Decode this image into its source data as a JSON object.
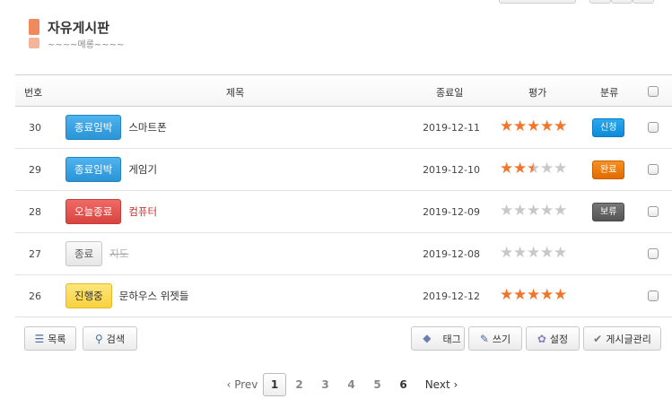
{
  "board": {
    "title": "자유게시판",
    "subtitle": "~~~~메롱~~~~"
  },
  "table": {
    "headers": {
      "no": "번호",
      "title": "제목",
      "end_date": "종료일",
      "rating": "평가",
      "category": "분류"
    },
    "rows": [
      {
        "no": "30",
        "tag": "종료임박",
        "title": "스마트폰",
        "date": "2019-12-11",
        "rating": 5,
        "category": "신청"
      },
      {
        "no": "29",
        "tag": "종료임박",
        "title": "게임기",
        "date": "2019-12-10",
        "rating": 2.5,
        "category": "완료"
      },
      {
        "no": "28",
        "tag": "오늘종료",
        "title": "컴퓨터",
        "date": "2019-12-09",
        "rating": 0,
        "category": "보류"
      },
      {
        "no": "27",
        "tag": "종료",
        "title": "지도",
        "date": "2019-12-08",
        "rating": 0,
        "category": ""
      },
      {
        "no": "26",
        "tag": "진행중",
        "title": "문하우스 위젯들",
        "date": "2019-12-12",
        "rating": 5,
        "category": ""
      }
    ]
  },
  "actions": {
    "list": "목록",
    "search": "검색",
    "tag": "태그",
    "write": "쓰기",
    "settings": "설정",
    "manage": "게시글관리"
  },
  "pagination": {
    "prev": "Prev",
    "next": "Next",
    "pages": [
      "1",
      "2",
      "3",
      "4",
      "5",
      "6"
    ],
    "current": "1"
  },
  "colors": {
    "accent": "#f08a5d",
    "tag_blue": "#2a94d6",
    "tag_red": "#d9443f",
    "tag_yellow": "#f7d23e",
    "star_on": "#f2752a",
    "cat_blue": "#0f8ad8",
    "cat_orange": "#e06c00",
    "cat_dark": "#555555"
  },
  "icons": {
    "list": "list-icon",
    "search": "search-icon",
    "tag": "tag-icon",
    "write": "pencil-icon",
    "settings": "gear-icon",
    "manage": "check-icon",
    "prev": "chevron-left-icon",
    "next": "chevron-right-icon"
  }
}
